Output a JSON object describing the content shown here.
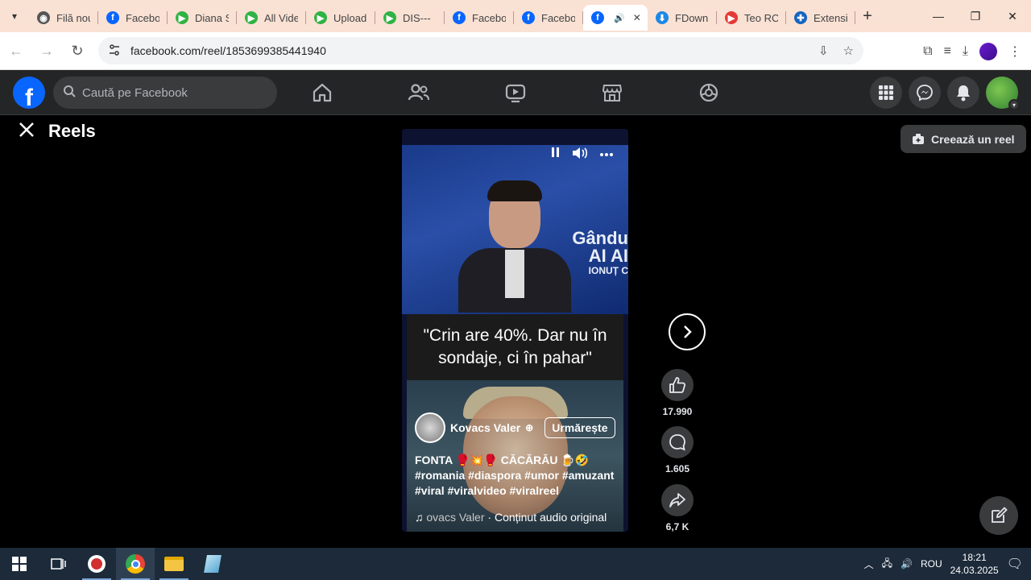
{
  "browser": {
    "tabs": [
      {
        "label": "Filă nou",
        "color": "#555555",
        "glyph": "◉"
      },
      {
        "label": "Facebo",
        "color": "#0866ff",
        "glyph": "f"
      },
      {
        "label": "Diana S",
        "color": "#2fb344",
        "glyph": "▶"
      },
      {
        "label": "All Vide",
        "color": "#2fb344",
        "glyph": "▶"
      },
      {
        "label": "Upload",
        "color": "#2fb344",
        "glyph": "▶"
      },
      {
        "label": "DIS---",
        "color": "#2fb344",
        "glyph": "▶"
      },
      {
        "label": "Facebo",
        "color": "#0866ff",
        "glyph": "f"
      },
      {
        "label": "Facebo",
        "color": "#0866ff",
        "glyph": "f"
      },
      {
        "label": "",
        "color": "#0866ff",
        "glyph": "f",
        "active": true
      },
      {
        "label": "FDown",
        "color": "#1e88e5",
        "glyph": "⬇"
      },
      {
        "label": "Teo RO",
        "color": "#e53935",
        "glyph": "▶"
      },
      {
        "label": "Extensi",
        "color": "#1565c0",
        "glyph": "✚"
      }
    ],
    "url": "facebook.com/reel/1853699385441940"
  },
  "fb": {
    "search_placeholder": "Caută pe Facebook"
  },
  "reels": {
    "title": "Reels",
    "create_label": "Creează un reel",
    "watermark_line1": "Gându",
    "watermark_line2": "AI AI",
    "watermark_line3": "IONUȚ C",
    "quote": "\"Crin are 40%. Dar nu în sondaje, ci în pahar\"",
    "author": "Kovacs Valer",
    "follow_label": "Urmărește",
    "caption": "FONTA 🥊💥🥊 CĂCĂRĂU 🍺🤣 #romania #diaspora #umor #amuzant #viral #viralvideo #viralreel",
    "audio_author": "ovacs Valer",
    "audio_sep": " · ",
    "audio_text": "Conținut audio original",
    "likes": "17.990",
    "comments": "1.605",
    "shares": "6,7 K"
  },
  "taskbar": {
    "language": "ROU",
    "time": "18:21",
    "date": "24.03.2025"
  }
}
